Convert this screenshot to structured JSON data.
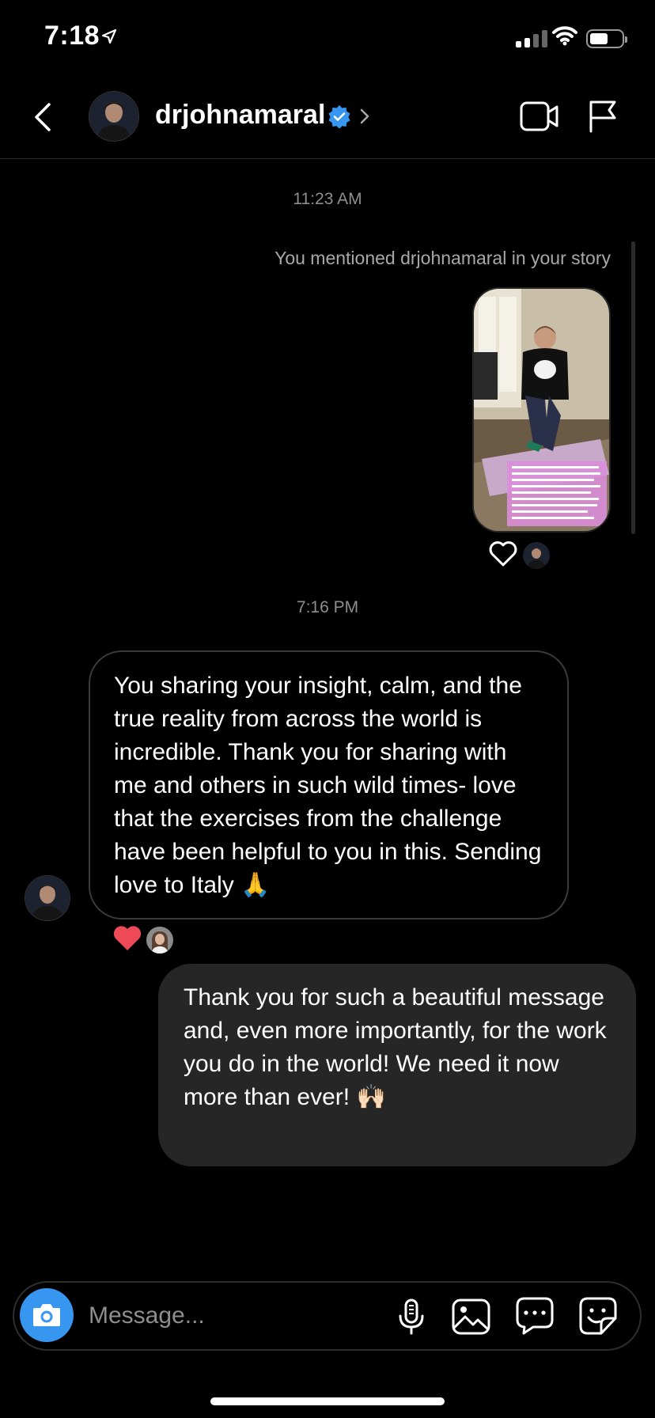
{
  "status_bar": {
    "time": "7:18"
  },
  "header": {
    "username": "drjohnamaral"
  },
  "thread": {
    "timestamp_1": "11:23 AM",
    "mention_note": "You mentioned drjohnamaral in your story",
    "timestamp_2": "7:16 PM",
    "received_message": "You sharing your insight, calm, and the true reality from across the world is incredible. Thank you for sharing with me and others in such wild times- love that the exercises from the challenge have been helpful to you in this. Sending love to Italy 🙏",
    "sent_message": "Thank you for such a beautiful message and, even more importantly, for the work you do in the world! We need it now more than ever! 🙌🏻",
    "story_reaction": "heart-outline",
    "message_reaction": "heart-red"
  },
  "composer": {
    "placeholder": "Message..."
  },
  "colors": {
    "accent": "#3797f0",
    "sent_bubble": "#262626",
    "heart": "#ed4956"
  }
}
